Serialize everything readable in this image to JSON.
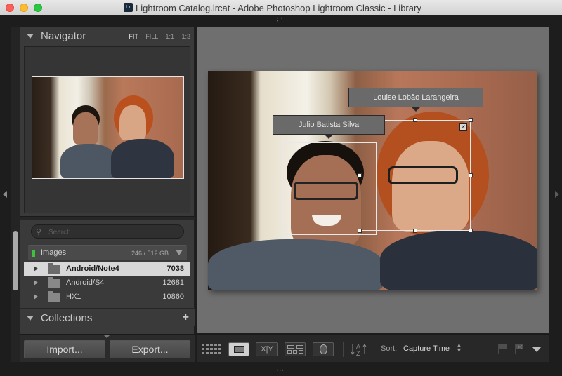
{
  "window": {
    "title": "Lightroom Catalog.lrcat - Adobe Photoshop Lightroom Classic - Library",
    "app_badge": "Lr"
  },
  "navigator": {
    "title": "Navigator",
    "zoom_options": [
      "FIT",
      "FILL",
      "1:1",
      "1:3"
    ]
  },
  "folders_panel": {
    "search_placeholder": "Search",
    "volume": {
      "name": "Images",
      "capacity": "246 / 512 GB"
    },
    "folders": [
      {
        "name": "Android/Note4",
        "count": "7038",
        "selected": true
      },
      {
        "name": "Android/S4",
        "count": "12681",
        "selected": false
      },
      {
        "name": "HX1",
        "count": "10860",
        "selected": false
      }
    ]
  },
  "collections": {
    "title": "Collections"
  },
  "bottom_buttons": {
    "import_label": "Import...",
    "export_label": "Export..."
  },
  "photo": {
    "face_tags": [
      {
        "name": "Julio Batista Silva"
      },
      {
        "name": "Louise Lobão Larangeira"
      }
    ]
  },
  "toolbar": {
    "compare_label": "X|Y",
    "sort_label": "Sort:",
    "sort_value": "Capture Time"
  },
  "colors": {
    "panel_bg": "#3a3a3a",
    "main_bg": "#6f6f6f",
    "selected_row": "#d8d8d8",
    "volume_led": "#3ec23c"
  },
  "icons": [
    "search-icon",
    "plus-icon",
    "grid-view-icon",
    "loupe-view-icon",
    "compare-view-icon",
    "survey-view-icon",
    "people-view-icon",
    "sort-order-icon",
    "flag-icon",
    "reject-flag-icon",
    "chevron-down-icon",
    "close-icon"
  ]
}
